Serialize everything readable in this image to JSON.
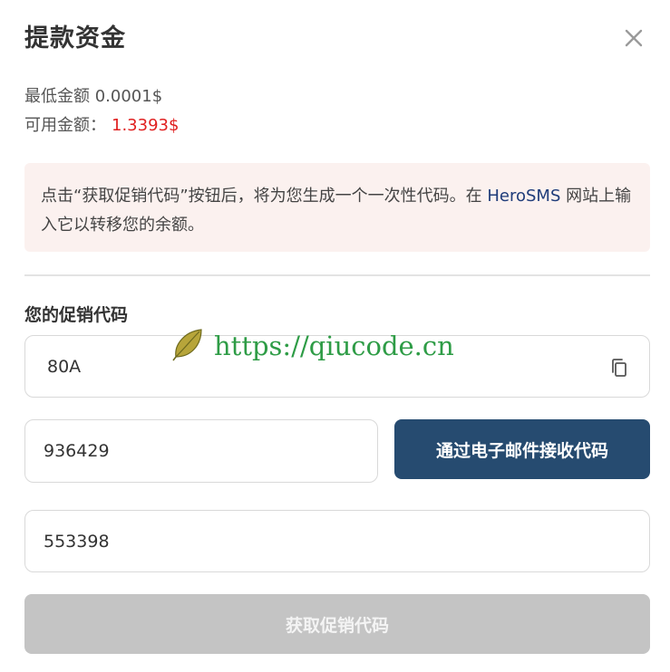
{
  "modal": {
    "title": "提款资金",
    "close_icon": "close-icon"
  },
  "info": {
    "min_amount_line": "最低金额 0.0001$",
    "available_label": "可用金额：",
    "available_value": "1.3393$",
    "available_color": "#e02020"
  },
  "notice": {
    "text_before": "点击“获取促销代码”按钮后，将为您生成一个一次性代码。在 ",
    "brand": "HeroSMS",
    "text_after": " 网站上输入它以转移您的余额。"
  },
  "promo": {
    "label": "您的促销代码",
    "value": "80A",
    "copy_icon": "copy-icon"
  },
  "email_code": {
    "value": "936429",
    "button_label": "通过电子邮件接收代码"
  },
  "second_code": {
    "value": "553398"
  },
  "get_promo_button": {
    "label": "获取促销代码",
    "disabled": true
  },
  "watermark": {
    "text": "https://qiucode.cn",
    "icon": "leaf-icon"
  },
  "colors": {
    "primary_button": "#264b70",
    "disabled_button": "#c4c4c4",
    "notice_bg": "#fbf1ef",
    "brand_link": "#1f3c7a"
  }
}
